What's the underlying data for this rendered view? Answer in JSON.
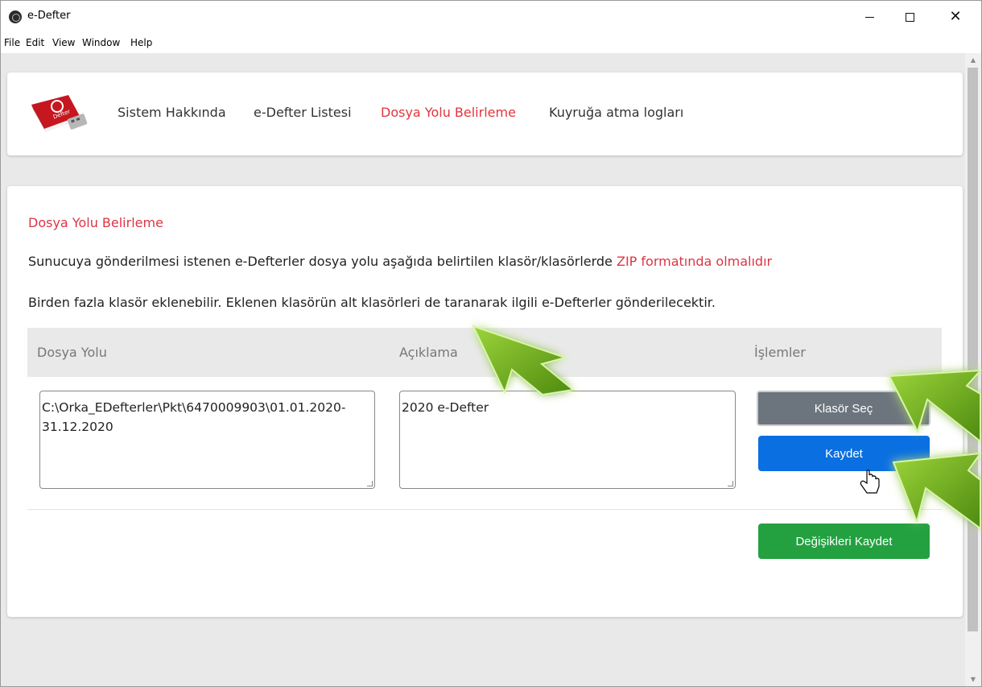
{
  "window": {
    "title": "e-Defter",
    "controls": {
      "minimize": "minimize",
      "maximize": "maximize",
      "close": "✕"
    }
  },
  "menu": [
    "File",
    "Edit",
    "View",
    "Window",
    "Help"
  ],
  "nav": {
    "logo_icon": "e-defter-book-usb-logo",
    "items": [
      {
        "label": "Sistem Hakkında",
        "active": false
      },
      {
        "label": "e-Defter Listesi",
        "active": false
      },
      {
        "label": "Dosya Yolu Belirleme",
        "active": true
      },
      {
        "label": "Kuyruğa atma logları",
        "active": false
      }
    ]
  },
  "page": {
    "title": "Dosya Yolu Belirleme",
    "desc1_text": "Sunucuya gönderilmesi istenen e-Defterler dosya yolu aşağıda belirtilen klasör/klasörlerde ",
    "desc1_highlight": "ZIP formatında olmalıdır",
    "desc2": "Birden fazla klasör eklenebilir. Eklenen klasörün alt klasörleri de taranarak ilgili e-Defterler gönderilecektir."
  },
  "table": {
    "headers": {
      "path": "Dosya Yolu",
      "description": "Açıklama",
      "actions": "İşlemler"
    },
    "row": {
      "path": "C:\\Orka_EDefterler\\Pkt\\6470009903\\01.01.2020-31.12.2020",
      "description": "2020 e-Defter"
    }
  },
  "buttons": {
    "select_folder": "Klasör Seç",
    "save": "Kaydet",
    "save_changes": "Değişikleri Kaydet"
  },
  "colors": {
    "accent_red": "#dc3545",
    "button_grey": "#6c757d",
    "button_blue": "#0a6fe0",
    "button_green": "#23a140",
    "annotation_arrow": "#6fae1e"
  }
}
